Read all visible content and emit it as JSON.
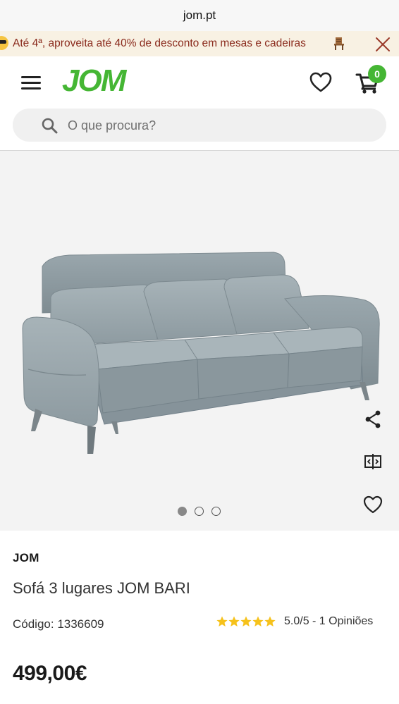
{
  "browser": {
    "url": "jom.pt"
  },
  "promo": {
    "text": "Até 4ª, aproveita até 40% de desconto em mesas e cadeiras",
    "emoji_icon": "sunglasses-face-icon",
    "chair_icon": "chair-icon",
    "close_icon": "close-icon",
    "text_color": "#8a2a1c",
    "background": "#f8f1e3"
  },
  "header": {
    "logo": "JOM",
    "logo_color": "#45b634",
    "cart_count": "0"
  },
  "search": {
    "placeholder": "O que procura?"
  },
  "gallery": {
    "image": "sofa-image",
    "slides": 3,
    "active_slide": 1,
    "actions": [
      "share-icon",
      "compare-icon",
      "heart-icon"
    ]
  },
  "product": {
    "brand": "JOM",
    "title": "Sofá 3 lugares JOM BARI",
    "code": "Código: 1336609",
    "rating_stars": 5,
    "rating_text": "5.0/5 - 1 Opiniões",
    "price": "499,00€"
  }
}
